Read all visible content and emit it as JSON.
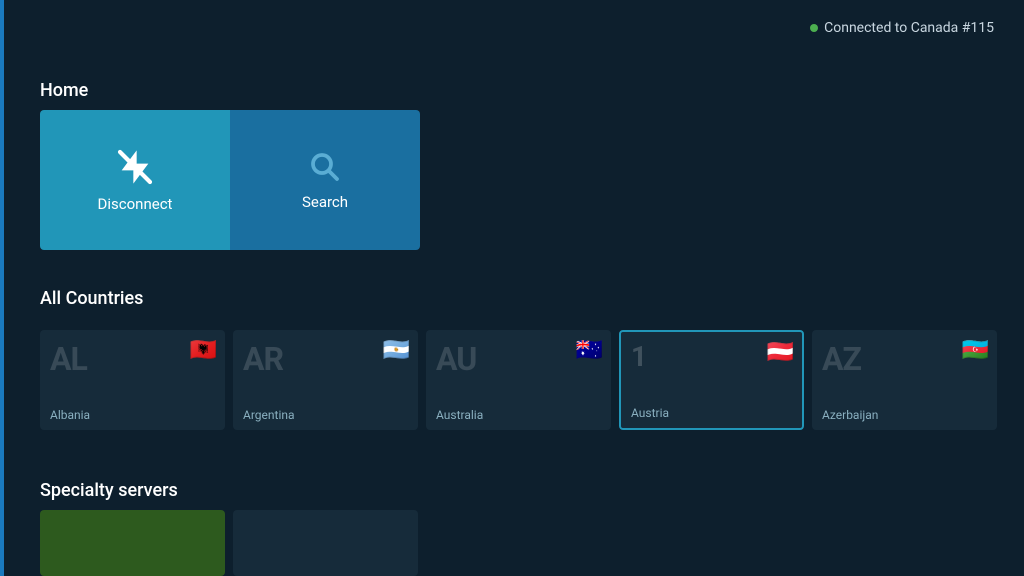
{
  "status": {
    "connected": true,
    "text": "Connected to Canada #115",
    "dot_color": "#4caf50"
  },
  "home": {
    "section_label": "Home",
    "cards": [
      {
        "id": "disconnect",
        "label": "Disconnect",
        "icon": "disconnect-icon",
        "focused": true
      },
      {
        "id": "search",
        "label": "Search",
        "icon": "search-icon",
        "focused": false
      }
    ]
  },
  "all_countries": {
    "section_label": "All Countries",
    "items": [
      {
        "abbr": "AL",
        "name": "Albania",
        "flag": "🇦🇱",
        "focused": false
      },
      {
        "abbr": "AR",
        "name": "Argentina",
        "flag": "🇦🇷",
        "focused": false
      },
      {
        "abbr": "AU",
        "name": "Australia",
        "flag": "🇦🇺",
        "focused": false
      },
      {
        "abbr": "1",
        "name": "Austria",
        "flag": "🇦🇹",
        "focused": true
      },
      {
        "abbr": "AZ",
        "name": "Azerbaijan",
        "flag": "🇦🇿",
        "focused": false
      }
    ]
  },
  "specialty_servers": {
    "section_label": "Specialty servers"
  }
}
